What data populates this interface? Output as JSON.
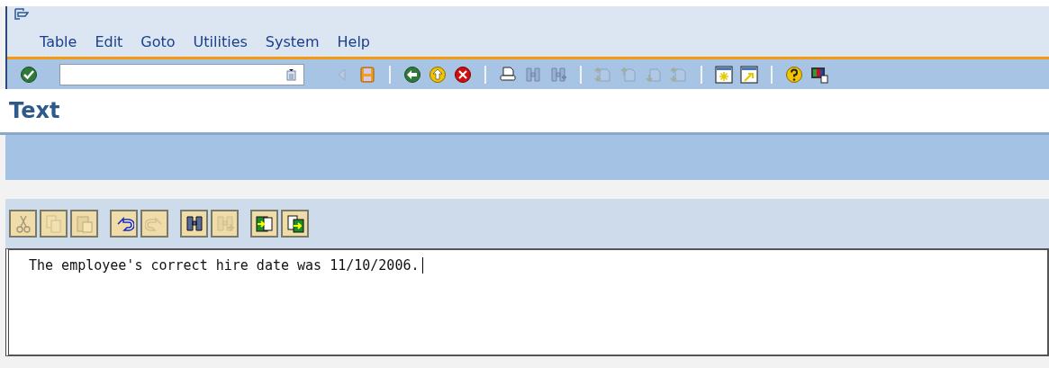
{
  "menu_bar": {
    "items": [
      {
        "label": "Table"
      },
      {
        "label": "Edit"
      },
      {
        "label": "Goto"
      },
      {
        "label": "Utilities"
      },
      {
        "label": "System"
      },
      {
        "label": "Help"
      }
    ]
  },
  "toolbar": {
    "items": [
      {
        "kind": "enter",
        "disabled": false
      },
      {
        "kind": "command-field"
      },
      {
        "kind": "triangle",
        "disabled": true
      },
      {
        "kind": "save",
        "disabled": false
      },
      {
        "kind": "separator"
      },
      {
        "kind": "back",
        "disabled": false
      },
      {
        "kind": "exit",
        "disabled": false
      },
      {
        "kind": "cancel",
        "disabled": false
      },
      {
        "kind": "separator"
      },
      {
        "kind": "print",
        "disabled": false
      },
      {
        "kind": "find",
        "disabled": true
      },
      {
        "kind": "find-next",
        "disabled": true
      },
      {
        "kind": "separator"
      },
      {
        "kind": "first-page",
        "disabled": true
      },
      {
        "kind": "previous-page",
        "disabled": true
      },
      {
        "kind": "next-page",
        "disabled": true
      },
      {
        "kind": "last-page",
        "disabled": true
      },
      {
        "kind": "separator"
      },
      {
        "kind": "new-session",
        "disabled": false
      },
      {
        "kind": "shortcut",
        "disabled": false
      },
      {
        "kind": "separator"
      },
      {
        "kind": "help",
        "disabled": false
      },
      {
        "kind": "layout",
        "disabled": false
      }
    ]
  },
  "title": "Text",
  "editor_toolbar": {
    "groups": [
      [
        {
          "kind": "cut",
          "disabled": true
        },
        {
          "kind": "copy",
          "disabled": true
        },
        {
          "kind": "paste",
          "disabled": true
        }
      ],
      [
        {
          "kind": "undo",
          "disabled": false
        },
        {
          "kind": "redo",
          "disabled": true
        }
      ],
      [
        {
          "kind": "find",
          "disabled": false
        },
        {
          "kind": "find-next",
          "disabled": true
        }
      ],
      [
        {
          "kind": "import",
          "disabled": false
        },
        {
          "kind": "export",
          "disabled": false
        }
      ]
    ]
  },
  "editor": {
    "text": "The employee's correct hire date was 11/10/2006."
  }
}
